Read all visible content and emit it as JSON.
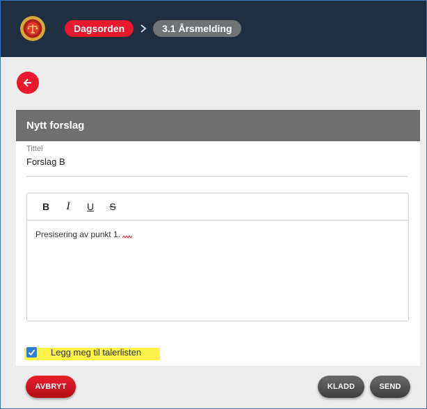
{
  "breadcrumb": {
    "items": [
      "Dagsorden",
      "3.1 Årsmelding"
    ]
  },
  "card": {
    "title": "Nytt forslag",
    "title_field": {
      "label": "Tittel",
      "value": "Forslag B"
    },
    "editor": {
      "toolbar": [
        "B",
        "I",
        "U",
        "S"
      ],
      "content": "Presisering av punkt 1."
    },
    "checkbox": {
      "label": "Legg meg til talerlisten",
      "checked": true
    },
    "buttons": {
      "cancel": "AVBRYT",
      "draft": "KLADD",
      "send": "SEND"
    }
  },
  "colors": {
    "topbar": "#1f2f40",
    "accent_red": "#e8192c",
    "crumb_grey": "#6f7377",
    "card_header": "#707070",
    "checkbox_blue": "#2f7fd6",
    "highlight_yellow": "#fbf24a"
  },
  "icons": [
    "logo-emblem-icon",
    "chevron-right-icon",
    "arrow-left-icon",
    "checkmark-icon"
  ]
}
